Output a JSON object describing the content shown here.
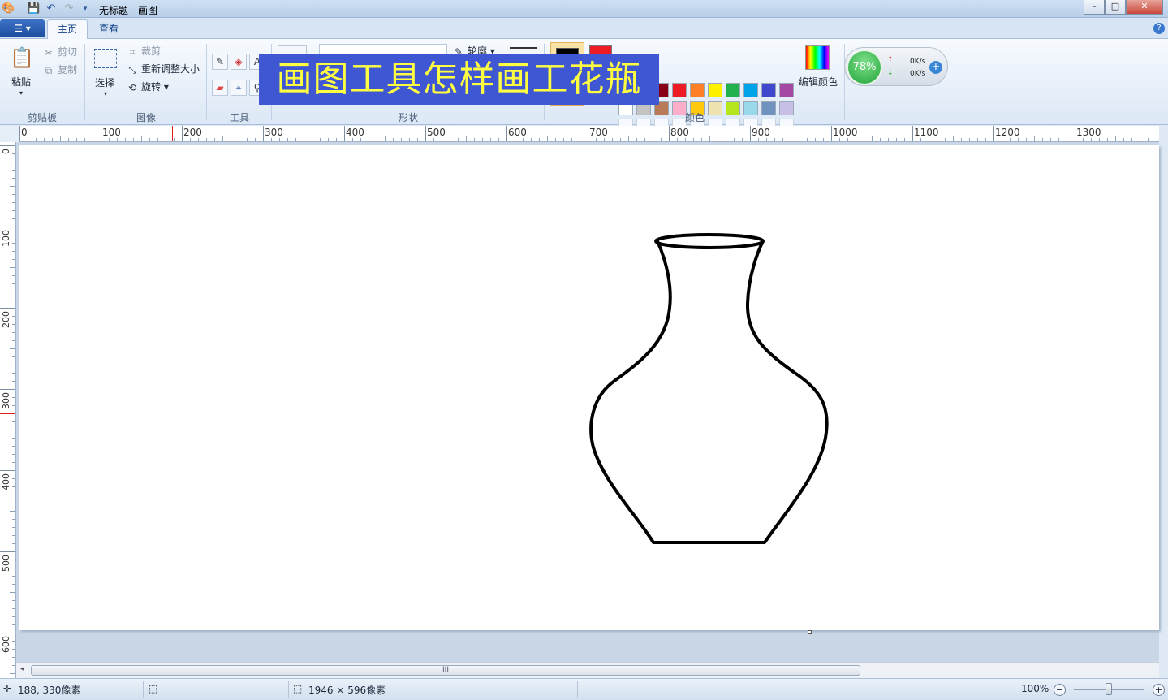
{
  "window": {
    "title": "无标题 - 画图",
    "controls": {
      "minimize": "–",
      "maximize": "□",
      "close": "✕"
    }
  },
  "tabs": [
    {
      "label": "主页",
      "active": true
    },
    {
      "label": "查看",
      "active": false
    }
  ],
  "ribbon": {
    "clipboard": {
      "paste": "粘贴",
      "cut": "剪切",
      "copy": "复制",
      "group": "剪贴板"
    },
    "image": {
      "select": "选择",
      "crop": "裁剪",
      "resize": "重新调整大小",
      "rotate": "旋转",
      "group": "图像"
    },
    "tools": {
      "group": "工具"
    },
    "shapes": {
      "outline": "轮廓",
      "group": "形状"
    },
    "colors": {
      "group": "颜色",
      "edit": "编辑颜色",
      "color1": "#000000",
      "color2": "#ed1c24",
      "palette_row1": [
        "#000000",
        "#7f7f7f",
        "#880015",
        "#ed1c24",
        "#ff7f27",
        "#fff200",
        "#22b14c",
        "#00a2e8",
        "#3f48cc",
        "#a349a4"
      ],
      "palette_row2": [
        "#ffffff",
        "#c3c3c3",
        "#b97a57",
        "#ffaec9",
        "#ffc90e",
        "#efe4b0",
        "#b5e61d",
        "#99d9ea",
        "#7092be",
        "#c8bfe7"
      ]
    }
  },
  "overlay_banner": "画图工具怎样画工花瓶",
  "net_widget": {
    "percent": "78%",
    "up": "0K/s",
    "down": "0K/s"
  },
  "rulers": {
    "horizontal_ticks": [
      "0",
      "100",
      "200",
      "300",
      "400",
      "500",
      "600",
      "700",
      "800",
      "900",
      "1000",
      "1100",
      "1200",
      "1300"
    ],
    "vertical_ticks": [
      "0",
      "100",
      "200",
      "300",
      "400",
      "500",
      "600"
    ]
  },
  "scrollbar": {
    "grip": "III"
  },
  "status": {
    "position": "188, 330像素",
    "canvas_size": "1946 × 596像素",
    "zoom": "100%"
  }
}
